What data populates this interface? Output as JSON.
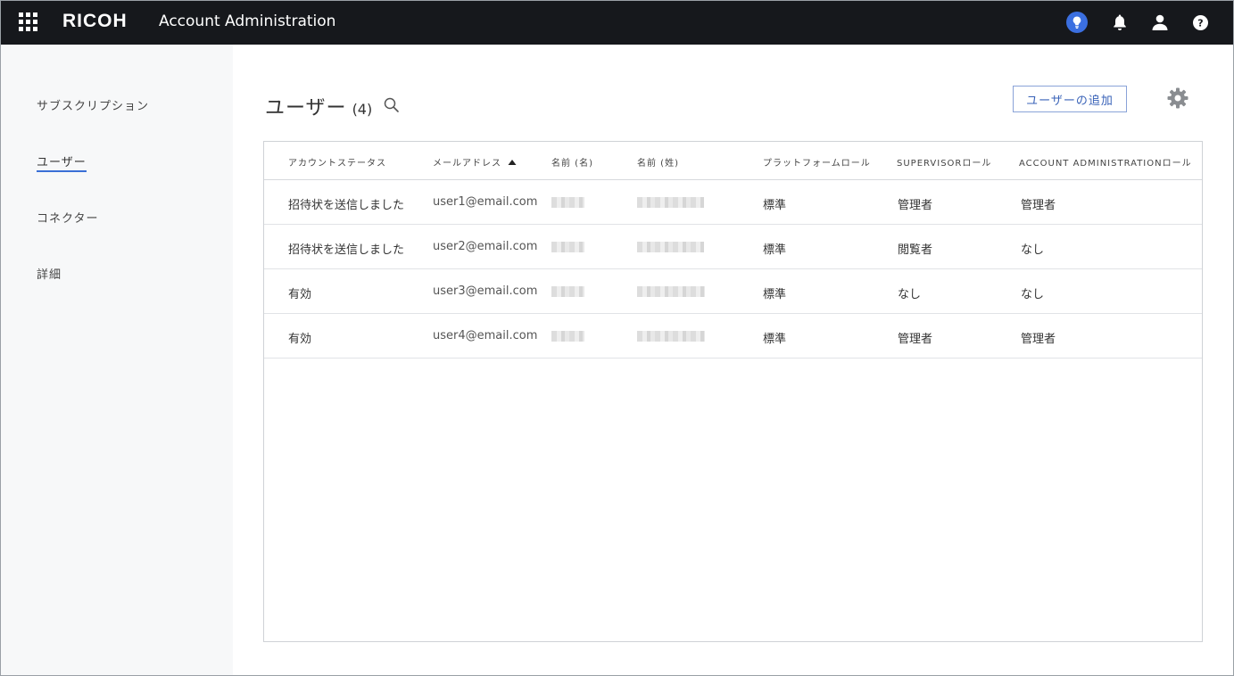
{
  "header": {
    "logo": "RICOH",
    "app_title": "Account Administration"
  },
  "icons": {
    "apps": "apps-grid-icon",
    "tips": "lightbulb-icon",
    "notifications": "bell-icon",
    "account": "user-icon",
    "help": "help-icon",
    "search": "search-icon",
    "settings": "gear-icon",
    "sort": "sort-ascending-icon"
  },
  "colors": {
    "topbar": "#16181c",
    "accent": "#3a6fd6",
    "tips_badge": "#3b6fe0"
  },
  "sidebar": {
    "items": [
      {
        "label": "サブスクリプション"
      },
      {
        "label": "ユーザー",
        "active": true
      },
      {
        "label": "コネクター"
      },
      {
        "label": "詳細"
      }
    ]
  },
  "main": {
    "title": "ユーザー",
    "count": "(4)",
    "add_user_label": "ユーザーの追加"
  },
  "table": {
    "columns": [
      "アカウントステータス",
      "メールアドレス",
      "名前 (名)",
      "名前 (姓)",
      "プラットフォームロール",
      "SUPERVISORロール",
      "ACCOUNT ADMINISTRATIONロール"
    ],
    "sorted_column": "メールアドレス",
    "rows": [
      [
        "招待状を送信しました",
        "user1@email.com",
        "",
        "",
        "標準",
        "管理者",
        "管理者"
      ],
      [
        "招待状を送信しました",
        "user2@email.com",
        "",
        "",
        "標準",
        "閲覧者",
        "なし"
      ],
      [
        "有効",
        "user3@email.com",
        "",
        "",
        "標準",
        "なし",
        "なし"
      ],
      [
        "有効",
        "user4@email.com",
        "",
        "",
        "標準",
        "管理者",
        "管理者"
      ]
    ]
  }
}
